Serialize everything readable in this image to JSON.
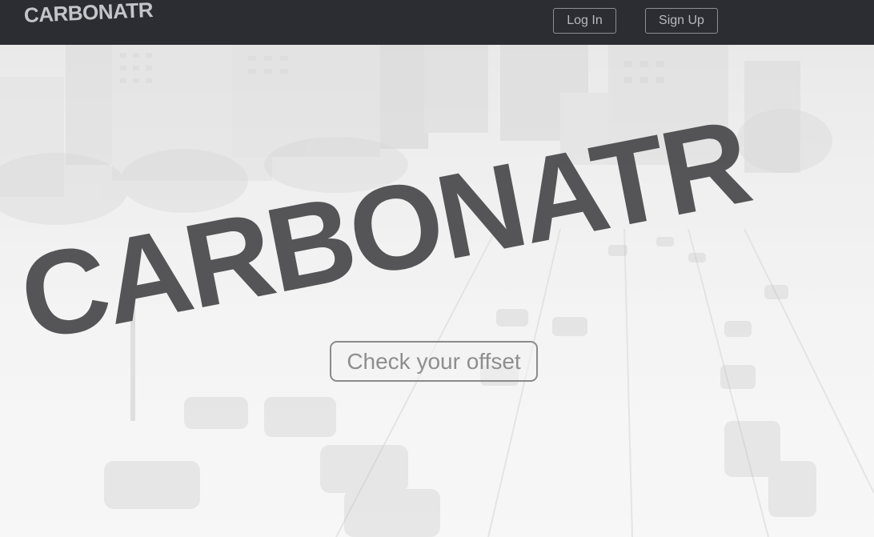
{
  "nav": {
    "brand": "CARBONATR",
    "login_label": "Log In",
    "signup_label": "Sign Up"
  },
  "hero": {
    "title": "CARBONATR",
    "cta_label": "Check your offset",
    "background_image": "faded grayscale city highway with buildings"
  },
  "colors": {
    "navbar": "#2b2d33",
    "brand_text": "#c4c5c8",
    "title_text": "#4a4a4c",
    "cta_text": "#8e8e8e"
  }
}
